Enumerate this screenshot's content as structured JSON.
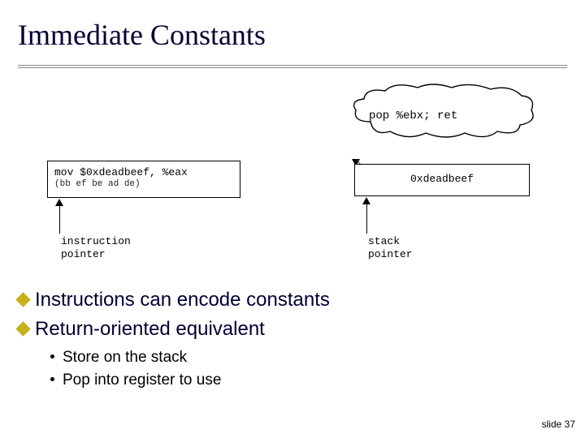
{
  "title": "Immediate Constants",
  "diagram": {
    "left_box_line1": "mov $0xdeadbeef, %eax",
    "left_box_line2": "(bb ef be ad de)",
    "left_caption_l1": "instruction",
    "left_caption_l2": "pointer",
    "right_box": "0xdeadbeef",
    "right_caption_l1": "stack",
    "right_caption_l2": "pointer",
    "cloud_text": "pop %ebx; ret"
  },
  "bullets": {
    "b1": "Instructions can encode constants",
    "b2": "Return-oriented equivalent",
    "s1": "Store on the stack",
    "s2": "Pop into register to use"
  },
  "footer": "slide 37"
}
